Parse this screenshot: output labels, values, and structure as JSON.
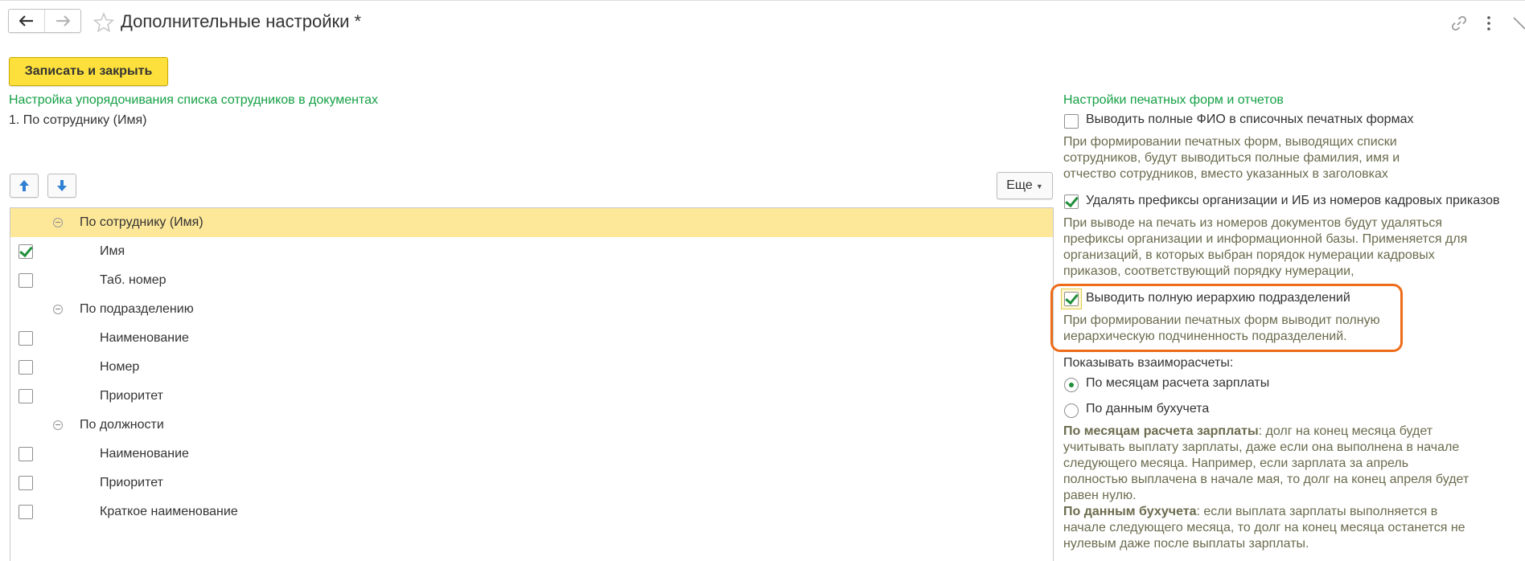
{
  "window": {
    "title": "Дополнительные настройки *"
  },
  "toolbar": {
    "save_close_label": "Записать и закрыть",
    "more_label": "Еще"
  },
  "ordering": {
    "section_title": "Настройка упорядочивания списка сотрудников в документах",
    "current_order": "1. По сотруднику (Имя)",
    "tree": [
      {
        "type": "group",
        "label": "По сотруднику (Имя)",
        "selected": true
      },
      {
        "type": "field",
        "label": "Имя",
        "checked": true
      },
      {
        "type": "field",
        "label": "Таб. номер",
        "checked": false
      },
      {
        "type": "group",
        "label": "По подразделению"
      },
      {
        "type": "field",
        "label": "Наименование",
        "checked": false
      },
      {
        "type": "field",
        "label": "Номер",
        "checked": false
      },
      {
        "type": "field",
        "label": "Приоритет",
        "checked": false
      },
      {
        "type": "group",
        "label": "По должности"
      },
      {
        "type": "field",
        "label": "Наименование",
        "checked": false
      },
      {
        "type": "field",
        "label": "Приоритет",
        "checked": false
      },
      {
        "type": "field",
        "label": "Краткое наименование",
        "checked": false
      }
    ]
  },
  "print_settings": {
    "section_title": "Настройки печатных форм и отчетов",
    "full_name": {
      "label": "Выводить полные ФИО в списочных печатных формах",
      "checked": false,
      "description": "При формировании печатных форм, выводящих списки сотрудников, будут выводиться полные фамилия, имя и отчество сотрудников, вместо указанных в заголовках"
    },
    "remove_prefixes": {
      "label": "Удалять префиксы организации и ИБ из номеров кадровых приказов",
      "checked": true,
      "description": "При выводе на печать из номеров документов будут удаляться префиксы организации и информационной базы. Применяется для организаций, в которых выбран порядок нумерации кадровых приказов, соответствующий порядку нумерации,"
    },
    "full_hierarchy": {
      "label": "Выводить полную иерархию подразделений",
      "checked": true,
      "description": "При формировании печатных форм выводит полную иерархическую подчиненность подразделений."
    },
    "settlements": {
      "label": "Показывать взаиморасчеты:",
      "options": [
        "По месяцам расчета зарплаты",
        "По данным бухучета"
      ],
      "selected": "По месяцам расчета зарплаты",
      "desc1_bold": "По месяцам расчета зарплаты",
      "desc1_text": ": долг на конец месяца будет учитывать выплату зарплаты, даже если она выполнена в начале следующего месяца. Например, если зарплата за апрель полностью выплачена в начале мая, то долг на конец апреля будет равен нулю.",
      "desc2_bold": "По данным бухучета",
      "desc2_text": ": если выплата зарплаты выполняется в начале следующего месяца, то долг на конец месяца останется не нулевым даже после выплаты зарплаты."
    }
  },
  "colors": {
    "accent_yellow": "#fde03b",
    "selected_row": "#fde799",
    "section_green": "#15a045",
    "check_green": "#1f8f3a",
    "highlight_orange": "#ee6c19"
  },
  "icons": [
    "back-arrow-icon",
    "forward-arrow-icon",
    "star-icon",
    "link-icon",
    "more-vertical-icon",
    "close-icon",
    "move-up-icon",
    "move-down-icon",
    "collapse-icon"
  ]
}
